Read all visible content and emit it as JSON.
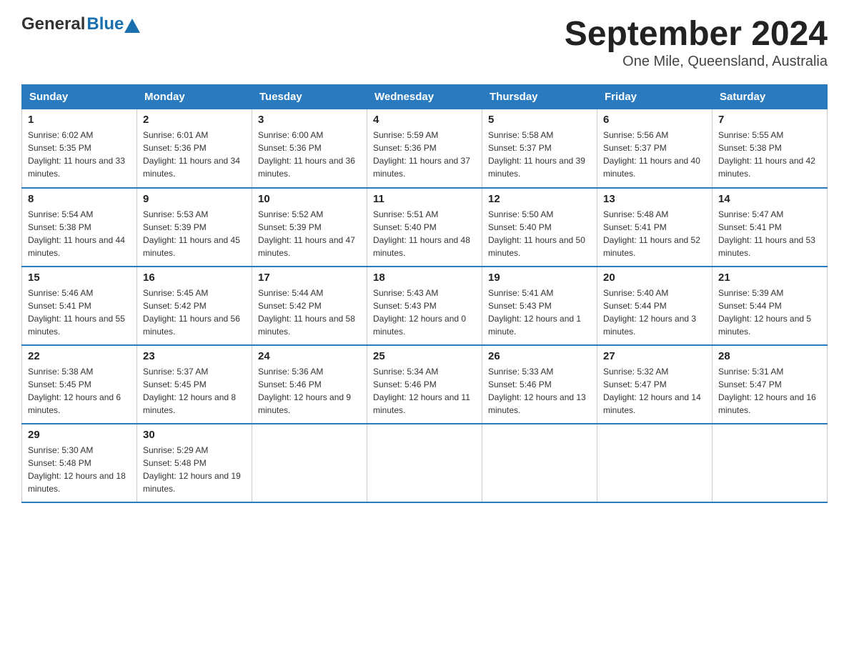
{
  "header": {
    "logo_general": "General",
    "logo_blue": "Blue",
    "title": "September 2024",
    "subtitle": "One Mile, Queensland, Australia"
  },
  "columns": [
    "Sunday",
    "Monday",
    "Tuesday",
    "Wednesday",
    "Thursday",
    "Friday",
    "Saturday"
  ],
  "weeks": [
    [
      {
        "day": "1",
        "sunrise": "6:02 AM",
        "sunset": "5:35 PM",
        "daylight": "11 hours and 33 minutes."
      },
      {
        "day": "2",
        "sunrise": "6:01 AM",
        "sunset": "5:36 PM",
        "daylight": "11 hours and 34 minutes."
      },
      {
        "day": "3",
        "sunrise": "6:00 AM",
        "sunset": "5:36 PM",
        "daylight": "11 hours and 36 minutes."
      },
      {
        "day": "4",
        "sunrise": "5:59 AM",
        "sunset": "5:36 PM",
        "daylight": "11 hours and 37 minutes."
      },
      {
        "day": "5",
        "sunrise": "5:58 AM",
        "sunset": "5:37 PM",
        "daylight": "11 hours and 39 minutes."
      },
      {
        "day": "6",
        "sunrise": "5:56 AM",
        "sunset": "5:37 PM",
        "daylight": "11 hours and 40 minutes."
      },
      {
        "day": "7",
        "sunrise": "5:55 AM",
        "sunset": "5:38 PM",
        "daylight": "11 hours and 42 minutes."
      }
    ],
    [
      {
        "day": "8",
        "sunrise": "5:54 AM",
        "sunset": "5:38 PM",
        "daylight": "11 hours and 44 minutes."
      },
      {
        "day": "9",
        "sunrise": "5:53 AM",
        "sunset": "5:39 PM",
        "daylight": "11 hours and 45 minutes."
      },
      {
        "day": "10",
        "sunrise": "5:52 AM",
        "sunset": "5:39 PM",
        "daylight": "11 hours and 47 minutes."
      },
      {
        "day": "11",
        "sunrise": "5:51 AM",
        "sunset": "5:40 PM",
        "daylight": "11 hours and 48 minutes."
      },
      {
        "day": "12",
        "sunrise": "5:50 AM",
        "sunset": "5:40 PM",
        "daylight": "11 hours and 50 minutes."
      },
      {
        "day": "13",
        "sunrise": "5:48 AM",
        "sunset": "5:41 PM",
        "daylight": "11 hours and 52 minutes."
      },
      {
        "day": "14",
        "sunrise": "5:47 AM",
        "sunset": "5:41 PM",
        "daylight": "11 hours and 53 minutes."
      }
    ],
    [
      {
        "day": "15",
        "sunrise": "5:46 AM",
        "sunset": "5:41 PM",
        "daylight": "11 hours and 55 minutes."
      },
      {
        "day": "16",
        "sunrise": "5:45 AM",
        "sunset": "5:42 PM",
        "daylight": "11 hours and 56 minutes."
      },
      {
        "day": "17",
        "sunrise": "5:44 AM",
        "sunset": "5:42 PM",
        "daylight": "11 hours and 58 minutes."
      },
      {
        "day": "18",
        "sunrise": "5:43 AM",
        "sunset": "5:43 PM",
        "daylight": "12 hours and 0 minutes."
      },
      {
        "day": "19",
        "sunrise": "5:41 AM",
        "sunset": "5:43 PM",
        "daylight": "12 hours and 1 minute."
      },
      {
        "day": "20",
        "sunrise": "5:40 AM",
        "sunset": "5:44 PM",
        "daylight": "12 hours and 3 minutes."
      },
      {
        "day": "21",
        "sunrise": "5:39 AM",
        "sunset": "5:44 PM",
        "daylight": "12 hours and 5 minutes."
      }
    ],
    [
      {
        "day": "22",
        "sunrise": "5:38 AM",
        "sunset": "5:45 PM",
        "daylight": "12 hours and 6 minutes."
      },
      {
        "day": "23",
        "sunrise": "5:37 AM",
        "sunset": "5:45 PM",
        "daylight": "12 hours and 8 minutes."
      },
      {
        "day": "24",
        "sunrise": "5:36 AM",
        "sunset": "5:46 PM",
        "daylight": "12 hours and 9 minutes."
      },
      {
        "day": "25",
        "sunrise": "5:34 AM",
        "sunset": "5:46 PM",
        "daylight": "12 hours and 11 minutes."
      },
      {
        "day": "26",
        "sunrise": "5:33 AM",
        "sunset": "5:46 PM",
        "daylight": "12 hours and 13 minutes."
      },
      {
        "day": "27",
        "sunrise": "5:32 AM",
        "sunset": "5:47 PM",
        "daylight": "12 hours and 14 minutes."
      },
      {
        "day": "28",
        "sunrise": "5:31 AM",
        "sunset": "5:47 PM",
        "daylight": "12 hours and 16 minutes."
      }
    ],
    [
      {
        "day": "29",
        "sunrise": "5:30 AM",
        "sunset": "5:48 PM",
        "daylight": "12 hours and 18 minutes."
      },
      {
        "day": "30",
        "sunrise": "5:29 AM",
        "sunset": "5:48 PM",
        "daylight": "12 hours and 19 minutes."
      },
      null,
      null,
      null,
      null,
      null
    ]
  ],
  "day_labels": {
    "sunrise": "Sunrise:",
    "sunset": "Sunset:",
    "daylight": "Daylight:"
  }
}
